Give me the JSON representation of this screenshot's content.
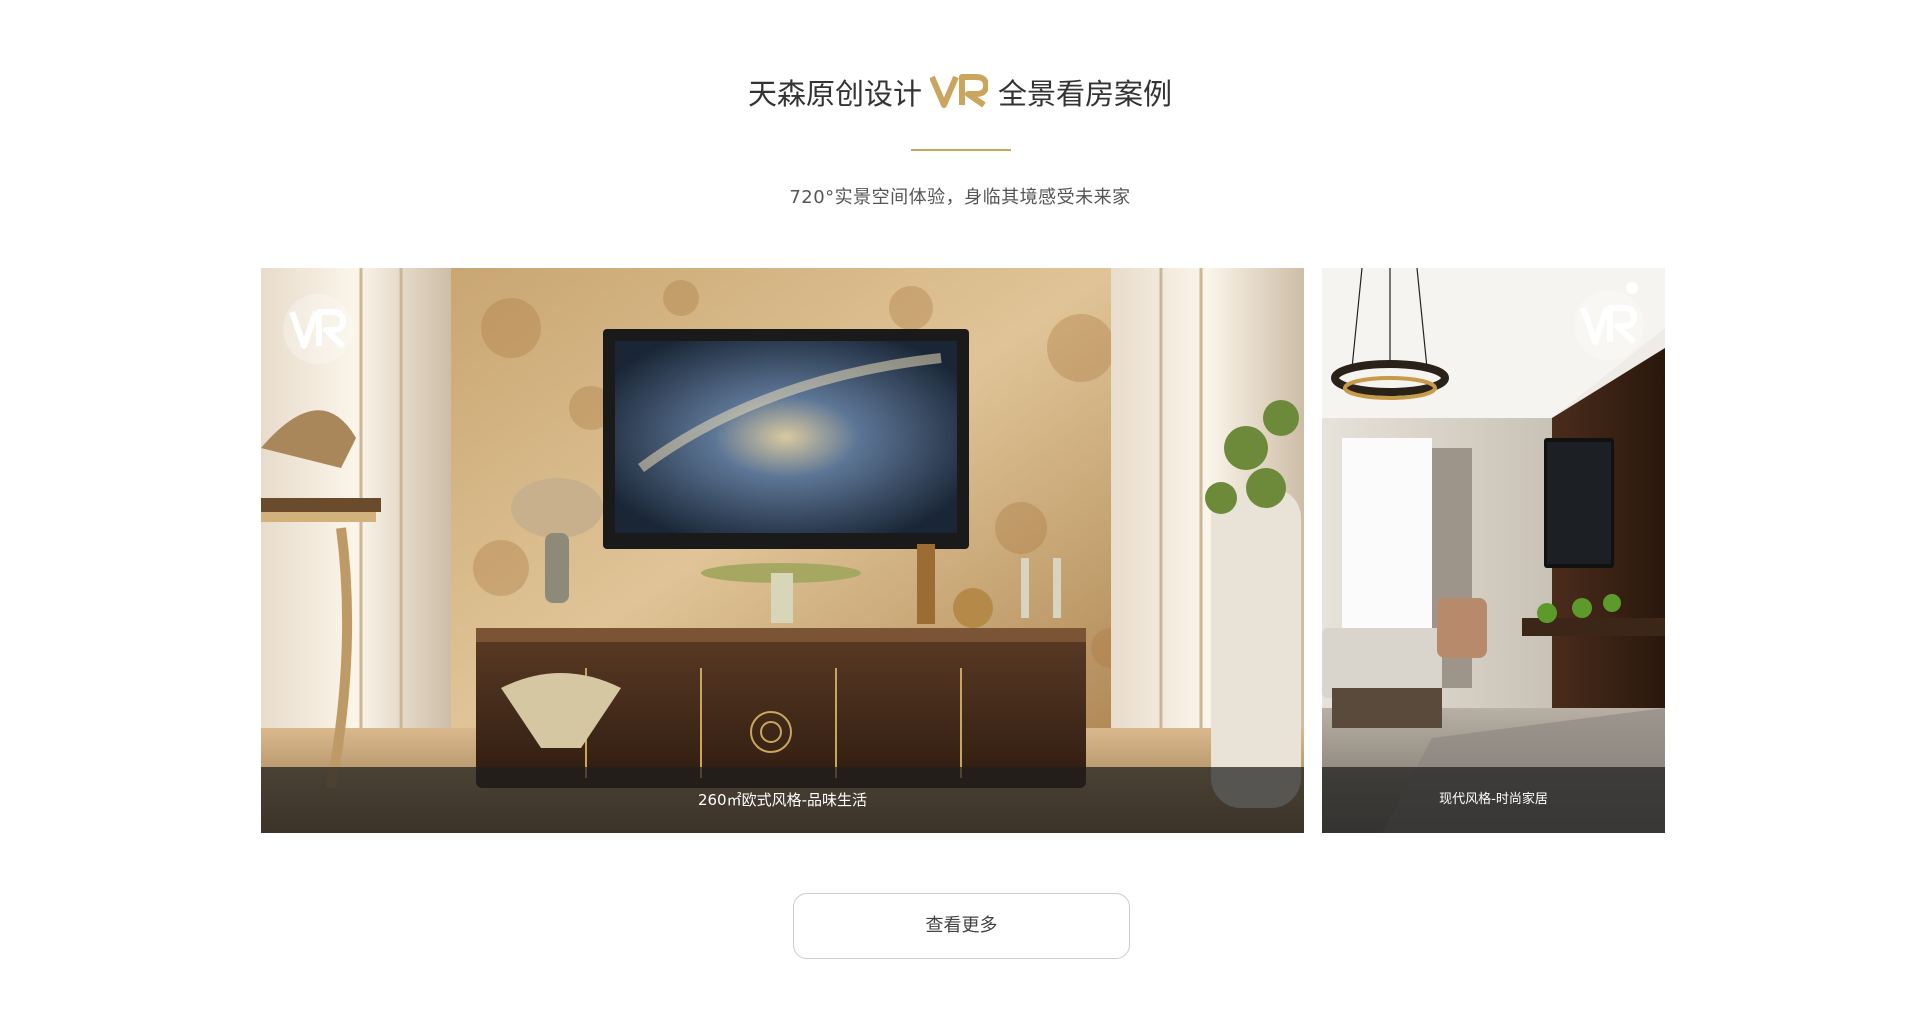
{
  "section": {
    "title_left": "天森原创设计",
    "title_right": "全景看房案例",
    "subtitle": "720°实景空间体验，身临其境感受未来家",
    "accent_color": "#c9a55e"
  },
  "cards": [
    {
      "caption": "260㎡欧式风格-品味生活",
      "badge_icon": "vr-icon"
    },
    {
      "caption": "现代风格-时尚家居",
      "badge_icon": "vr-icon"
    }
  ],
  "more_button": {
    "label": "查看更多"
  }
}
